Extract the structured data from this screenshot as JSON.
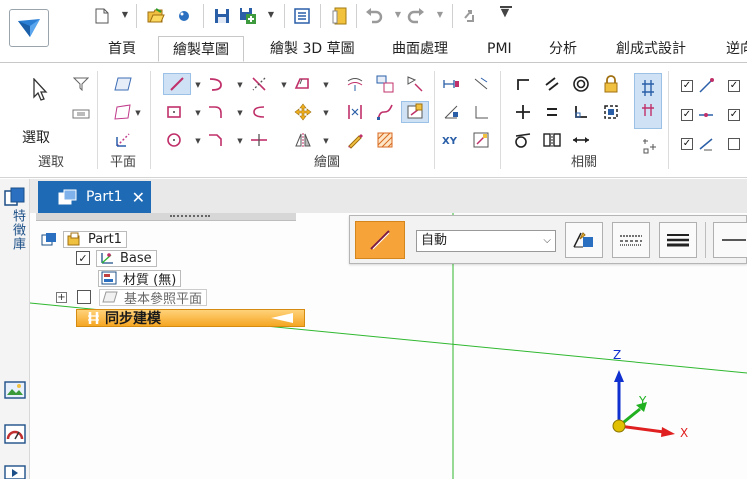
{
  "ribbon_tabs": [
    "首頁",
    "繪製草圖",
    "繪製 3D 草圖",
    "曲面處理",
    "PMI",
    "分析",
    "創成式設計",
    "逆向"
  ],
  "active_tab": "繪製草圖",
  "groups": {
    "select": {
      "button_label": "選取",
      "label": "選取"
    },
    "plane": {
      "label": "平面"
    },
    "draw": {
      "label": "繪圖"
    },
    "relate": {
      "label": "相關"
    }
  },
  "icons": {
    "app": "app-menu-icon",
    "qat": [
      "new-document-icon",
      "open-icon",
      "help-icon",
      "save-icon",
      "save-as-icon",
      "properties-icon",
      "document-icon",
      "undo-icon",
      "redo-icon",
      "customize-icon"
    ]
  },
  "sidebar": {
    "library_label": "特徵庫"
  },
  "document_tab": {
    "title": "Part1",
    "close_glyph": "✕"
  },
  "tree": {
    "root": "Part1",
    "base": "Base",
    "material": "材質 (無)",
    "ref_planes": "基本參照平面",
    "sync": "同步建模"
  },
  "command_bar": {
    "mode_value": "自動"
  },
  "triad": {
    "z": "Z",
    "y": "Y",
    "x": "X"
  },
  "colors": {
    "accent": "#1e6ab5",
    "sync_bar": "#f5a623",
    "axis_green": "#00c000",
    "axis_x": "#e02020",
    "axis_y": "#20b020",
    "axis_z": "#1030d0"
  }
}
